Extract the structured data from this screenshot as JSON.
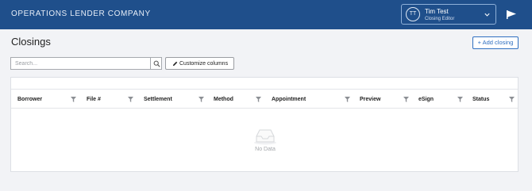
{
  "header": {
    "company": "OPERATIONS LENDER COMPANY",
    "user": {
      "initials": "TT",
      "name": "Tim Test",
      "role": "Closing Editor"
    },
    "icons": [
      "user-avatar",
      "chevron-down-icon",
      "flag-icon"
    ]
  },
  "page": {
    "title": "Closings",
    "add_button": "+ Add closing"
  },
  "toolbar": {
    "search_placeholder": "Search...",
    "customize_label": "Customize columns",
    "icons": [
      "search-icon",
      "pencil-icon"
    ]
  },
  "table": {
    "columns": [
      "Borrower",
      "File #",
      "Settlement",
      "Method",
      "Appointment",
      "Preview",
      "eSign",
      "Status"
    ],
    "empty_text": "No Data"
  },
  "colors": {
    "header_bg": "#1f4f8b",
    "accent": "#2f6fc0",
    "page_bg": "#f2f3f6"
  }
}
